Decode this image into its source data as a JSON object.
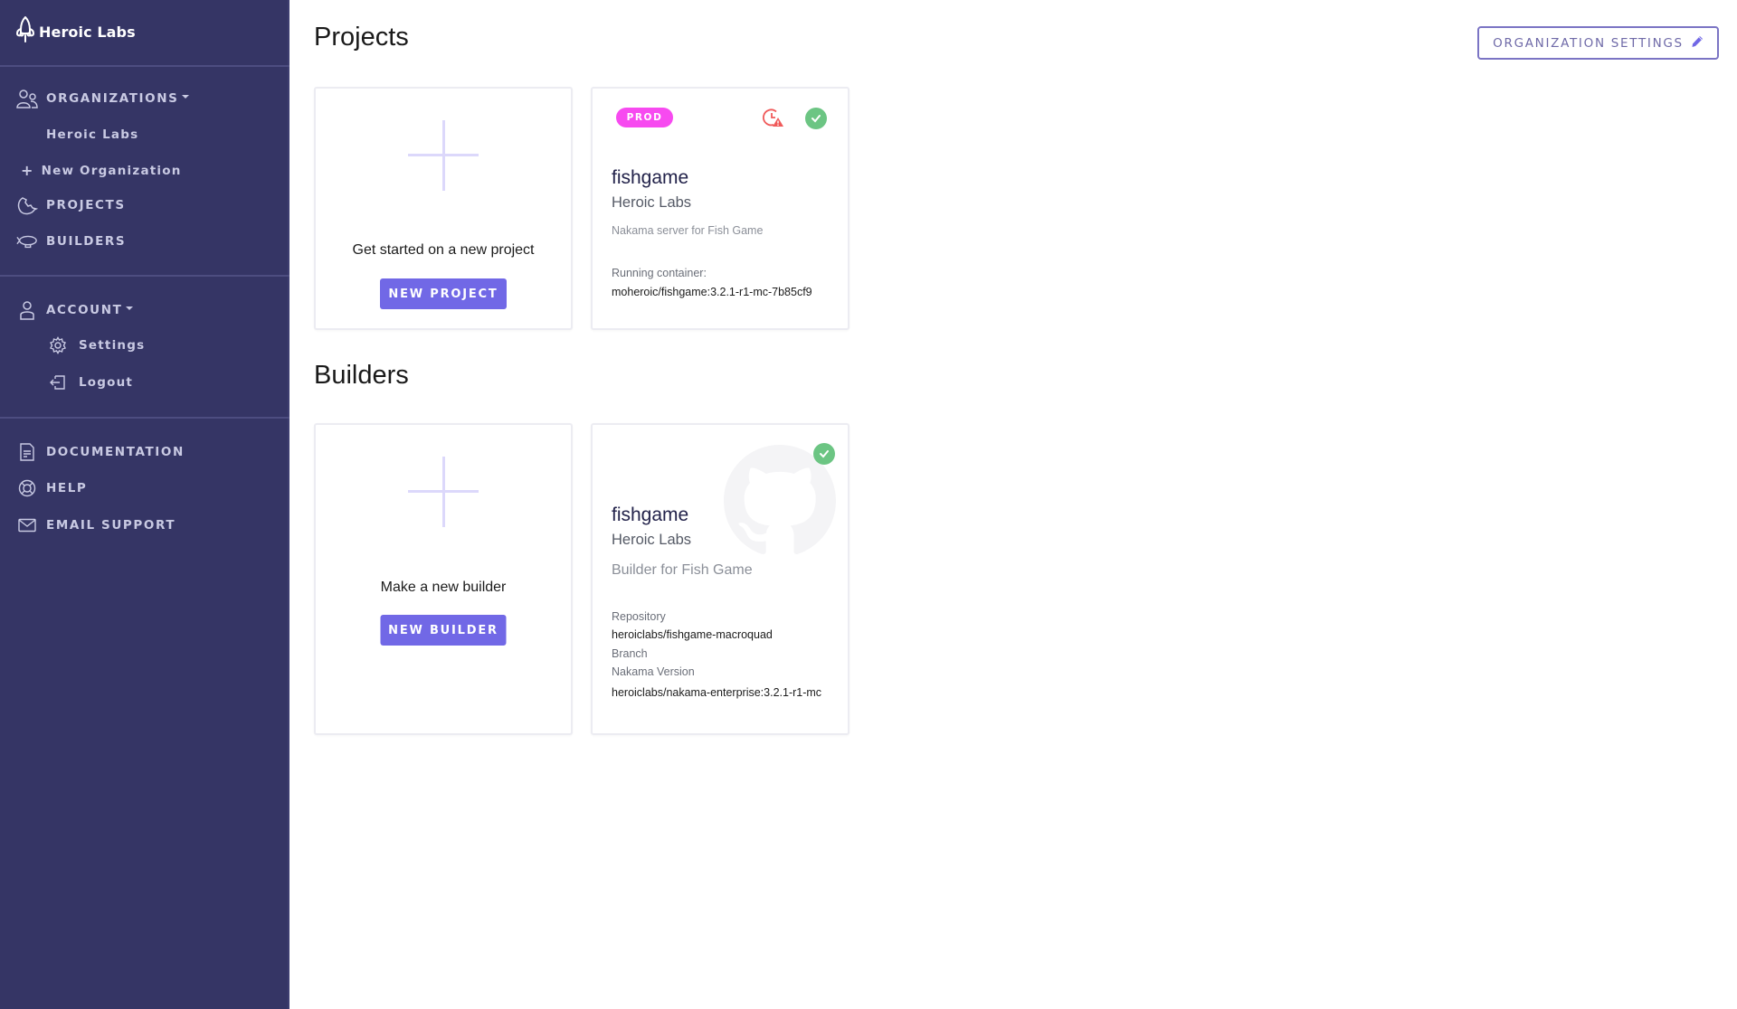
{
  "brand": {
    "name": "Heroic Labs",
    "icon": "rocket-icon"
  },
  "sidebar": {
    "organizations": {
      "label": "ORGANIZATIONS",
      "icon": "users-icon",
      "expanded": true,
      "items": [
        {
          "label": "Heroic Labs"
        }
      ],
      "new_org": {
        "label": "New Organization",
        "icon": "plus-icon"
      }
    },
    "projects": {
      "label": "PROJECTS",
      "icon": "projects-icon"
    },
    "builders": {
      "label": "BUILDERS",
      "icon": "blimp-icon"
    },
    "account": {
      "label": "ACCOUNT",
      "icon": "user-icon",
      "expanded": true,
      "items": [
        {
          "label": "Settings",
          "icon": "gear-icon"
        },
        {
          "label": "Logout",
          "icon": "logout-icon"
        }
      ]
    },
    "documentation": {
      "label": "DOCUMENTATION",
      "icon": "document-icon"
    },
    "help": {
      "label": "HELP",
      "icon": "lifebuoy-icon"
    },
    "email_support": {
      "label": "EMAIL SUPPORT",
      "icon": "mail-icon"
    }
  },
  "header": {
    "org_settings_label": "ORGANIZATION SETTINGS",
    "org_settings_icon": "pencil-icon"
  },
  "projects": {
    "title": "Projects",
    "new_card": {
      "text": "Get started on a new project",
      "button": "NEW PROJECT"
    },
    "items": [
      {
        "badge": "PROD",
        "name": "fishgame",
        "org": "Heroic Labs",
        "description": "Nakama server for Fish Game",
        "container_label": "Running container:",
        "container_value": "moheroic/fishgame:3.2.1-r1-mc-7b85cf9",
        "status_icons": [
          "clock-warning-icon",
          "check-circle-icon"
        ],
        "colors": {
          "badge": "#f74af0",
          "ok": "#6cc583",
          "warning": "#f05a5a"
        }
      }
    ]
  },
  "builders": {
    "title": "Builders",
    "new_card": {
      "text": "Make a new builder",
      "button": "NEW BUILDER"
    },
    "items": [
      {
        "name": "fishgame",
        "org": "Heroic Labs",
        "description": "Builder for Fish Game",
        "repository_label": "Repository",
        "repository_value": "heroiclabs/fishgame-macroquad",
        "branch_label": "Branch",
        "nakama_label": "Nakama Version",
        "nakama_value": "heroiclabs/nakama-enterprise:3.2.1-r1-mc",
        "status_icons": [
          "check-circle-icon"
        ],
        "watermark": "github-icon"
      }
    ]
  },
  "colors": {
    "sidebar_bg": "#353565",
    "accent": "#7168e6",
    "sidebar_text": "#c9cae3"
  }
}
